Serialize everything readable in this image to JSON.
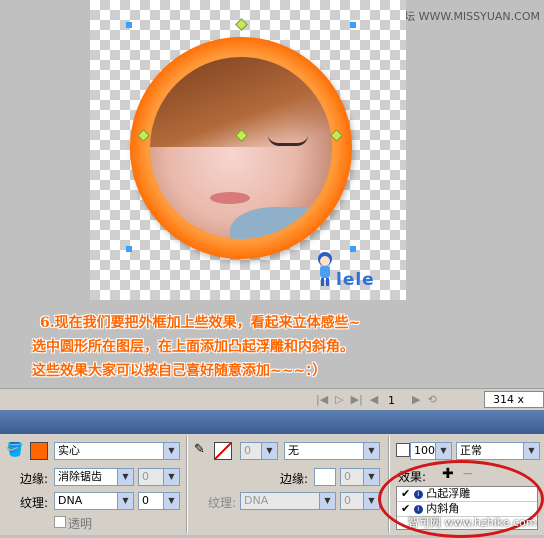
{
  "watermark_top": "思缘设计论坛 WWW.MISSYUAN.COM",
  "logo_text": "lele",
  "note_lines": [
    "6.现在我们要把外框加上些效果，看起来立体感些~",
    "选中圆形所在图层，在上面添加凸起浮雕和内斜角。",
    "这些效果大家可以按自己喜好随意添加~~~：）"
  ],
  "status": {
    "frame": "1",
    "size": "314 x 302"
  },
  "fill": {
    "color": "#ff6600",
    "type": "实心",
    "edge_label": "边缘:",
    "edge_value": "消除锯齿",
    "edge_amount": "0",
    "texture_label": "纹理:",
    "texture_value": "DNA",
    "texture_amount": "0",
    "transparent_label": "透明"
  },
  "stroke": {
    "width": "0",
    "type": "无",
    "edge_label": "边缘:",
    "edge_amount": "0",
    "texture_label": "纹理:",
    "texture_value": "DNA",
    "texture_amount": "0"
  },
  "layer": {
    "opacity": "100",
    "blend": "正常",
    "effects_label": "效果:",
    "effects": [
      "凸起浮雕",
      "内斜角"
    ]
  },
  "watermark_bottom": "智可网 www.hzhike.com"
}
